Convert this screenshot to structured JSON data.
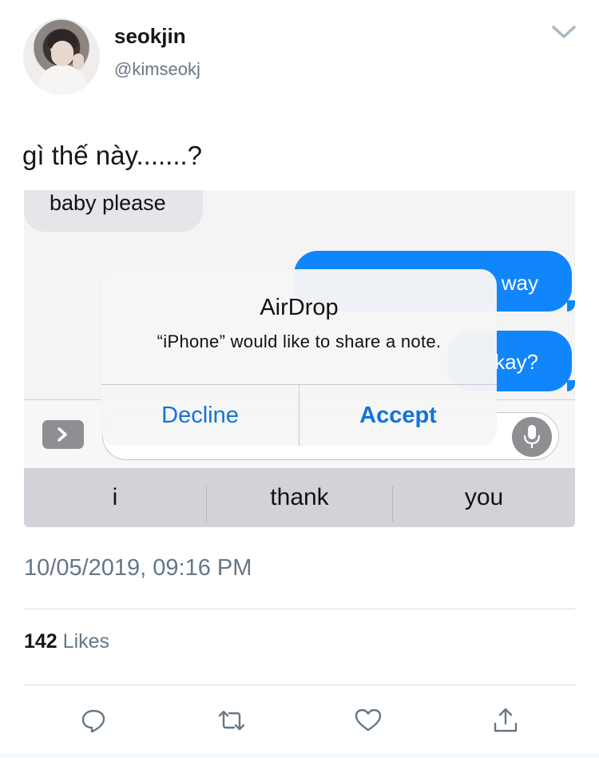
{
  "user": {
    "display_name": "seokjin",
    "handle": "@kimseokj"
  },
  "tweet": {
    "text": "gì thế này.......?",
    "timestamp": "10/05/2019, 09:16 PM",
    "likes_count": "142",
    "likes_label": "Likes"
  },
  "screenshot": {
    "incoming_message": "baby please",
    "outgoing_messages": [
      "way",
      "kay?"
    ],
    "alert": {
      "title": "AirDrop",
      "message": "“iPhone” would like to share a note.",
      "decline_label": "Decline",
      "accept_label": "Accept"
    },
    "predictive_words": [
      "i",
      "thank",
      "you"
    ]
  },
  "icons": {
    "menu": "chevron-down-icon",
    "apps": "chevron-right-icon",
    "dictation": "microphone-icon",
    "reply": "reply-icon",
    "retweet": "retweet-icon",
    "like": "heart-icon",
    "share": "share-icon"
  },
  "colors": {
    "imessage_blue": "#1185fb",
    "alert_button_blue": "#1273d9",
    "secondary_text": "#657786"
  }
}
